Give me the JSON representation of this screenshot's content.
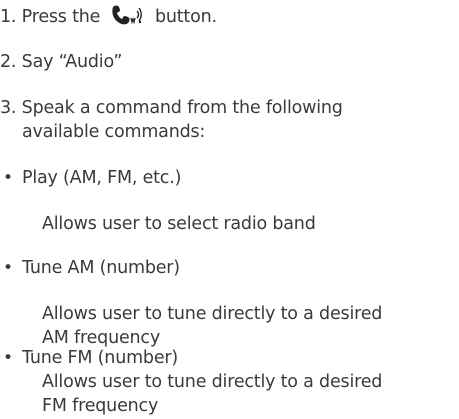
{
  "steps": [
    {
      "number": "1.",
      "before": "Press the",
      "icon": "talk-voice-icon",
      "after": "button."
    },
    {
      "number": "2.",
      "text": "Say “Audio”"
    },
    {
      "number": "3.",
      "line1": "Speak a command from the following",
      "line2": "available commands:"
    }
  ],
  "commands": [
    {
      "title": "Play (AM, FM, etc.)",
      "desc": [
        "Allows user to select radio band"
      ]
    },
    {
      "title": "Tune AM (number)",
      "desc": [
        "Allows user to tune directly to a desired",
        "AM frequency"
      ]
    },
    {
      "title": "Tune FM (number)",
      "desc": [
        "Allows user to tune directly to a desired",
        "FM frequency"
      ]
    }
  ],
  "bullet_glyph": "•",
  "text_color": "#3a3a3a"
}
